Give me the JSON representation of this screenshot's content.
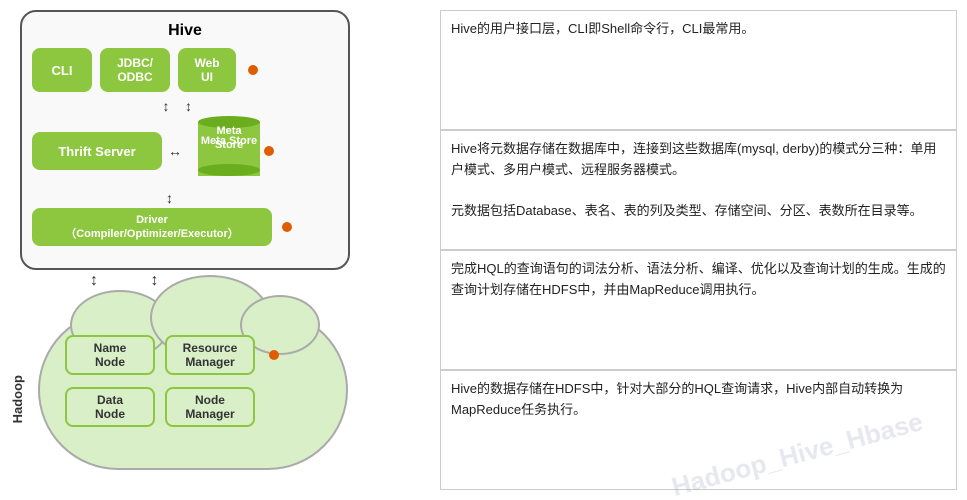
{
  "hive": {
    "title": "Hive",
    "cli_label": "CLI",
    "jdbc_label": "JDBC/\nODBC",
    "webui_label": "Web\nUI",
    "thrift_label": "Thrift Server",
    "meta_store_label": "Meta\nStore",
    "driver_label": "Driver\n（Compiler/Optimizer/Executor）"
  },
  "hadoop": {
    "title": "Hadoop",
    "name_node": "Name\nNode",
    "resource_manager": "Resource\nManager",
    "data_node": "Data\nNode",
    "node_manager": "Node\nManager"
  },
  "annotations": [
    {
      "id": "ann1",
      "text": "Hive的用户接口层，CLI即Shell命令行，CLI最常用。"
    },
    {
      "id": "ann2",
      "text": "Hive将元数据存储在数据库中，连接到这些数据库(mysql, derby)的模式分三种：单用户模式、多用户模式、远程服务器模式。\n\n元数据包括Database、表名、表的列及类型、存储空间、分区、表数所在目录等。"
    },
    {
      "id": "ann3",
      "text": "完成HQL的查询语句的词法分析、语法分析、编译、优化以及查询计划的生成。生成的查询计划存储在HDFS中，并由MapReduce调用执行。"
    },
    {
      "id": "ann4",
      "text": "Hive的数据存储在HDFS中，针对大部分的HQL查询请求，Hive内部自动转换为MapReduce任务执行。"
    }
  ],
  "watermark": "Hadoop_Hive_Hbase"
}
